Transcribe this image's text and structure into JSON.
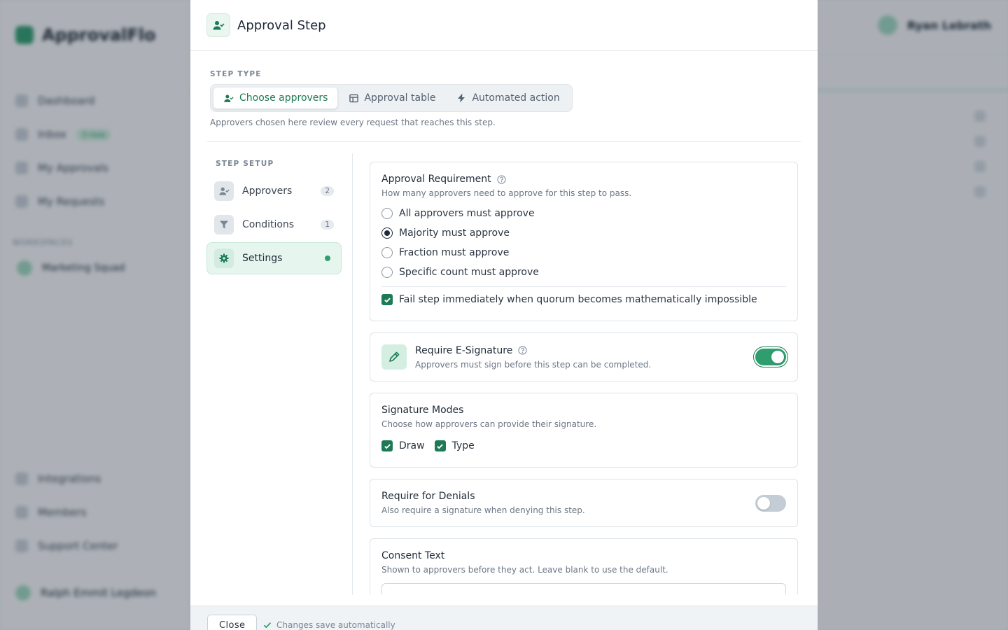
{
  "background": {
    "app_name": "ApprovalFlo",
    "nav": [
      {
        "label": "Dashboard"
      },
      {
        "label": "Inbox",
        "badge": "3 new"
      },
      {
        "label": "My Approvals"
      },
      {
        "label": "My Requests"
      }
    ],
    "section": "WORKSPACES",
    "team": "Marketing Squad",
    "bottom_nav": [
      {
        "label": "Integrations"
      },
      {
        "label": "Members"
      },
      {
        "label": "Support Center"
      }
    ],
    "user": "Ralph Emmit Legdeon",
    "profile_name": "Ryan Lebrath"
  },
  "modal": {
    "title": "Approval Step",
    "header_icon": "user-check-icon",
    "step_type": {
      "label": "STEP TYPE",
      "options": [
        {
          "label": "Choose approvers",
          "icon": "user-check-icon",
          "active": true
        },
        {
          "label": "Approval table",
          "icon": "table-icon",
          "active": false
        },
        {
          "label": "Automated action",
          "icon": "bolt-icon",
          "active": false
        }
      ],
      "hint": "Approvers chosen here review every request that reaches this step."
    },
    "step_setup": {
      "label": "STEP SETUP",
      "items": [
        {
          "label": "Approvers",
          "icon": "user-check-icon",
          "count": "2"
        },
        {
          "label": "Conditions",
          "icon": "filter-icon",
          "count": "1"
        },
        {
          "label": "Settings",
          "icon": "gear-icon",
          "active": true
        }
      ]
    },
    "approval_requirement": {
      "title": "Approval Requirement",
      "subtitle": "How many approvers need to approve for this step to pass.",
      "options": [
        {
          "label": "All approvers must approve",
          "checked": false
        },
        {
          "label": "Majority must approve",
          "checked": true
        },
        {
          "label": "Fraction must approve",
          "checked": false
        },
        {
          "label": "Specific count must approve",
          "checked": false
        }
      ],
      "fail_fast": {
        "label": "Fail step immediately when quorum becomes mathematically impossible",
        "checked": true
      }
    },
    "esignature": {
      "title": "Require E-Signature",
      "subtitle": "Approvers must sign before this step can be completed.",
      "enabled": true
    },
    "signature_modes": {
      "title": "Signature Modes",
      "subtitle": "Choose how approvers can provide their signature.",
      "modes": [
        {
          "label": "Draw",
          "checked": true
        },
        {
          "label": "Type",
          "checked": true
        }
      ]
    },
    "denials": {
      "title": "Require for Denials",
      "subtitle": "Also require a signature when denying this step.",
      "enabled": false
    },
    "consent": {
      "title": "Consent Text",
      "subtitle": "Shown to approvers before they act. Leave blank to use the default.",
      "value": ""
    },
    "footer": {
      "close_label": "Close",
      "save_note": "Changes save automatically"
    }
  },
  "colors": {
    "accent": "#2f9e6f",
    "accent_dark": "#1e7a56",
    "overlay": "#1c2634"
  }
}
